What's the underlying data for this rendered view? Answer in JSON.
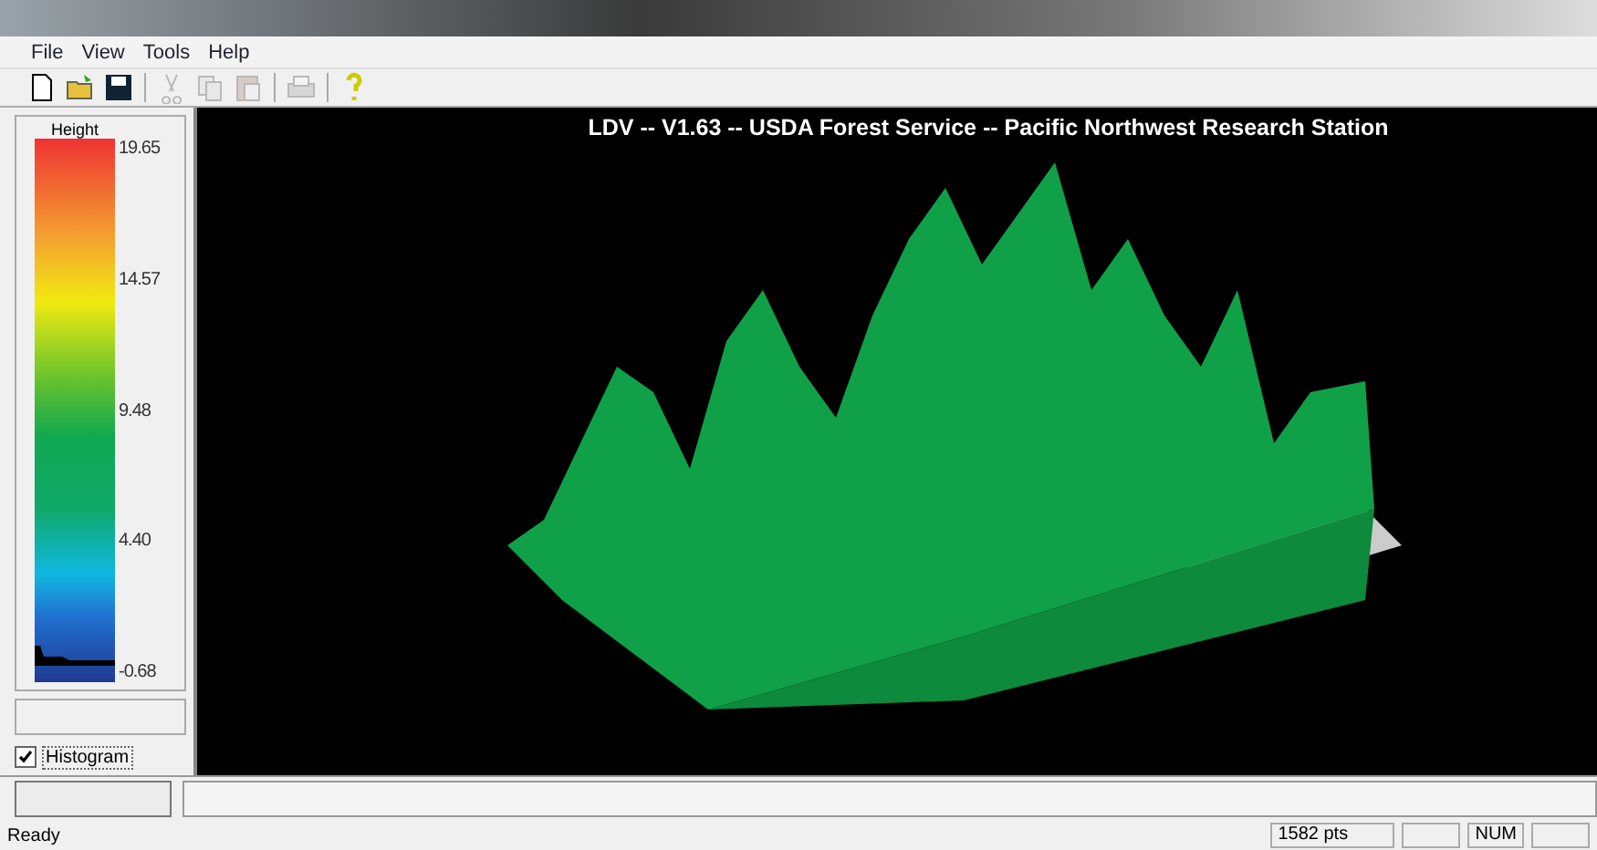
{
  "menu": [
    "File",
    "View",
    "Tools",
    "Help"
  ],
  "toolbar": [
    {
      "kind": "new",
      "disabled": false
    },
    {
      "kind": "open",
      "disabled": false
    },
    {
      "kind": "save",
      "disabled": false
    },
    {
      "kind": "sep"
    },
    {
      "kind": "cut",
      "disabled": true
    },
    {
      "kind": "copy",
      "disabled": true
    },
    {
      "kind": "paste",
      "disabled": true
    },
    {
      "kind": "sep"
    },
    {
      "kind": "print",
      "disabled": true
    },
    {
      "kind": "sep"
    },
    {
      "kind": "help",
      "disabled": false
    }
  ],
  "legend": {
    "title": "Height",
    "ticks": [
      "19.65",
      "14.57",
      "9.48",
      "4.40",
      "-0.68"
    ]
  },
  "histogram": {
    "label": "Histogram",
    "checked": true
  },
  "viewer": {
    "title": "LDV -- V1.63 -- USDA Forest Service -- Pacific Northwest Research Station"
  },
  "status_bar": {
    "message": "Ready",
    "points": "1582 pts",
    "num": "NUM"
  }
}
